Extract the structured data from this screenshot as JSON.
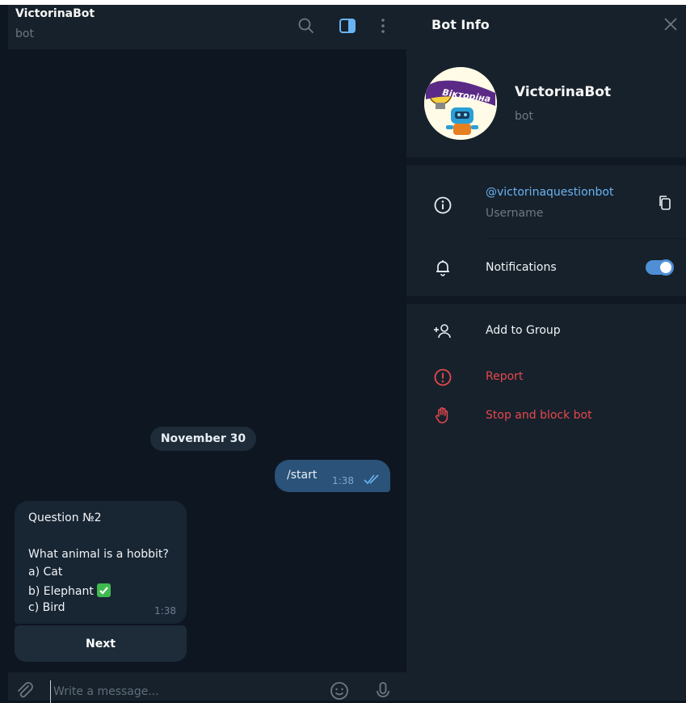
{
  "chat": {
    "title": "VictorinaBot",
    "subtitle": "bot",
    "date_separator": "November 30",
    "outgoing": {
      "text": "/start",
      "time": "1:38"
    },
    "incoming": {
      "lines": [
        "Question №2",
        "",
        "What animal is a hobbit?",
        "a) Cat",
        "b) Elephant",
        "c) Bird"
      ],
      "emoji": "✅",
      "time": "1:38"
    },
    "keyboard_button": "Next",
    "composer_placeholder": "Write a message..."
  },
  "info": {
    "title": "Bot Info",
    "bot_name": "VictorinaBot",
    "bot_sub": "bot",
    "avatar_text": "Вікторіна",
    "username": "@victorinaquestionbot",
    "username_label": "Username",
    "notifications_label": "Notifications",
    "notifications_on": true,
    "add_to_group": "Add to Group",
    "report": "Report",
    "stop_block": "Stop and block bot"
  },
  "colors": {
    "chat_bg": "#0e1621",
    "panel_bg": "#17212b",
    "outgoing_bubble": "#2b5278",
    "incoming_bubble": "#182533",
    "accent": "#6ab3f3",
    "danger": "#e5484d"
  },
  "icons": [
    "search-icon",
    "sidebar-toggle-icon",
    "more-icon",
    "close-icon",
    "info-icon",
    "copy-icon",
    "bell-icon",
    "add-user-icon",
    "report-icon",
    "stop-hand-icon",
    "attach-icon",
    "emoji-icon",
    "microphone-icon",
    "double-check-icon"
  ]
}
